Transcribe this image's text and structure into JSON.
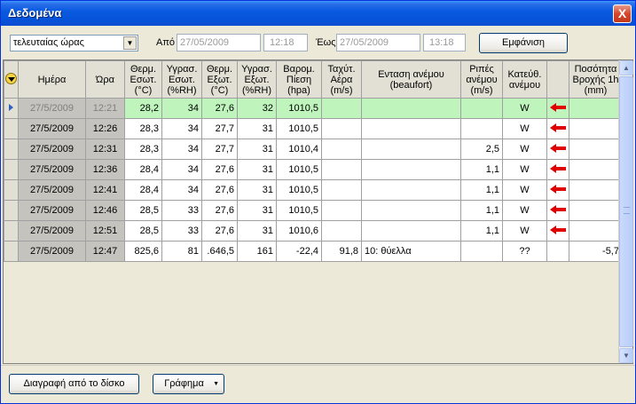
{
  "window": {
    "title": "Δεδομένα",
    "close": "X"
  },
  "filter": {
    "period": "τελευταίας ώρας",
    "from_label": "Από",
    "from_date": "27/05/2009",
    "from_time": "12:18",
    "to_label": "Έως",
    "to_date": "27/05/2009",
    "to_time": "13:18",
    "show_button": "Εμφάνιση"
  },
  "table": {
    "columns": [
      "Ημέρα",
      "Ώρα",
      "Θερμ. Εσωτ. (°C)",
      "Υγρασ. Εσωτ. (%RH)",
      "Θερμ. Εξωτ. (°C)",
      "Υγρασ. Εξωτ. (%RH)",
      "Βαρομ. Πίεση (hpa)",
      "Ταχύτ. Αέρα (m/s)",
      "Ενταση ανέμου (beaufort)",
      "Ριπές ανέμου (m/s)",
      "Κατεύθ. ανέμου",
      "",
      "Ποσότητα Βροχής 1h (mm)"
    ],
    "rows": [
      [
        "27/5/2009",
        "12:21",
        "28,2",
        "34",
        "27,6",
        "32",
        "1010,5",
        "",
        "",
        "",
        "W",
        "arrow-left",
        ""
      ],
      [
        "27/5/2009",
        "12:26",
        "28,3",
        "34",
        "27,7",
        "31",
        "1010,5",
        "",
        "",
        "",
        "W",
        "arrow-left",
        ""
      ],
      [
        "27/5/2009",
        "12:31",
        "28,3",
        "34",
        "27,7",
        "31",
        "1010,4",
        "",
        "",
        "2,5",
        "W",
        "arrow-left",
        ""
      ],
      [
        "27/5/2009",
        "12:36",
        "28,4",
        "34",
        "27,6",
        "31",
        "1010,5",
        "",
        "",
        "1,1",
        "W",
        "arrow-left",
        ""
      ],
      [
        "27/5/2009",
        "12:41",
        "28,4",
        "34",
        "27,6",
        "31",
        "1010,5",
        "",
        "",
        "1,1",
        "W",
        "arrow-left",
        ""
      ],
      [
        "27/5/2009",
        "12:46",
        "28,5",
        "33",
        "27,6",
        "31",
        "1010,5",
        "",
        "",
        "1,1",
        "W",
        "arrow-left",
        ""
      ],
      [
        "27/5/2009",
        "12:51",
        "28,5",
        "33",
        "27,6",
        "31",
        "1010,6",
        "",
        "",
        "1,1",
        "W",
        "arrow-left",
        ""
      ],
      [
        "27/5/2009",
        "12:47",
        "825,6",
        "81",
        ".646,5",
        "161",
        "-22,4",
        "91,8",
        "10: θύελλα",
        "",
        "??",
        "",
        "-5,7"
      ]
    ],
    "selected_row": 0
  },
  "bottom": {
    "delete_button": "Διαγραφή από το δίσκο",
    "chart_button": "Γράφημα"
  }
}
